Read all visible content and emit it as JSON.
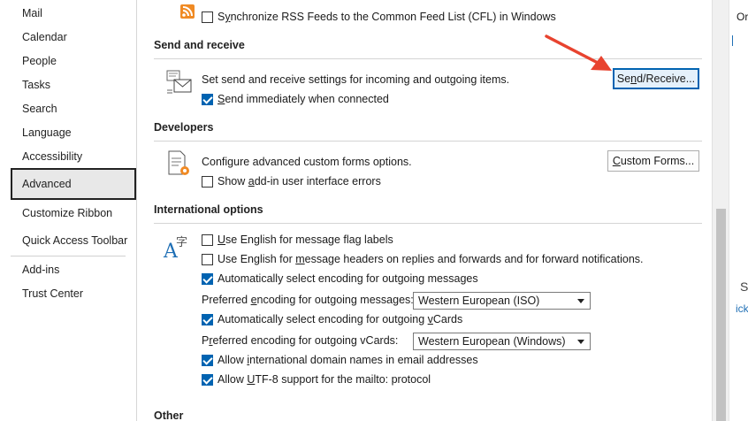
{
  "sidebar": {
    "items": [
      {
        "label": "Mail"
      },
      {
        "label": "Calendar"
      },
      {
        "label": "People"
      },
      {
        "label": "Tasks"
      },
      {
        "label": "Search"
      },
      {
        "label": "Language"
      },
      {
        "label": "Accessibility"
      },
      {
        "label": "Advanced"
      },
      {
        "label": "Customize Ribbon"
      },
      {
        "label": "Quick Access Toolbar"
      },
      {
        "label": "Add-ins"
      },
      {
        "label": "Trust Center"
      }
    ],
    "selected": "Advanced"
  },
  "rss": {
    "sync_label_pre": "S",
    "sync_label_u": "y",
    "sync_label_post": "nchronize RSS Feeds to the Common Feed List (CFL) in Windows"
  },
  "send_receive": {
    "header": "Send and receive",
    "description": "Set send and receive settings for incoming and outgoing items.",
    "button_pre": "Se",
    "button_u": "n",
    "button_post": "d/Receive...",
    "send_immediately_u": "S",
    "send_immediately_post": "end immediately when connected"
  },
  "developers": {
    "header": "Developers",
    "description": "Configure advanced custom forms options.",
    "button_u": "C",
    "button_post": "ustom Forms...",
    "addin_errors_pre": "Show ",
    "addin_errors_u": "a",
    "addin_errors_post": "dd-in user interface errors"
  },
  "international": {
    "header": "International options",
    "opt1_u": "U",
    "opt1_post": "se English for message flag labels",
    "opt2_pre": "Use English for ",
    "opt2_u": "m",
    "opt2_post": "essage headers on replies and forwards and for forward notifications.",
    "opt3": "Automatically select encoding for outgoing messages",
    "enc_msg_label_pre": "Preferred ",
    "enc_msg_label_u": "e",
    "enc_msg_label_post": "ncoding for outgoing messages:",
    "enc_msg_value": "Western European (ISO)",
    "opt4_pre": "Automatically select encoding for outgoing ",
    "opt4_u": "v",
    "opt4_post": "Cards",
    "enc_vcard_label_pre": "P",
    "enc_vcard_label_u": "r",
    "enc_vcard_label_post": "eferred encoding for outgoing vCards:",
    "enc_vcard_value": "Western European (Windows)",
    "opt5_pre": "Allow ",
    "opt5_u": "i",
    "opt5_post": "nternational domain names in email addresses",
    "opt6_pre": "Allow ",
    "opt6_u": "U",
    "opt6_post": "TF-8 support for the mailto: protocol"
  },
  "other": {
    "header": "Other"
  },
  "right_edge": {
    "top_text": "Or",
    "mid_text": "S",
    "link_text": "ick"
  },
  "colors": {
    "accent": "#0063b1",
    "arrow": "#e8432f"
  }
}
